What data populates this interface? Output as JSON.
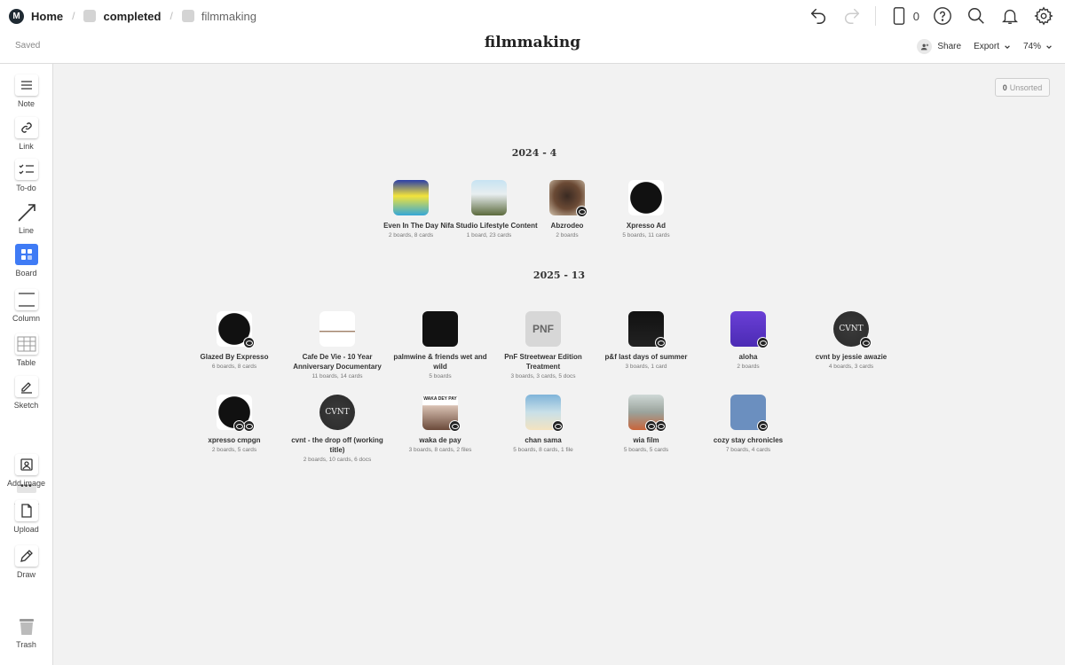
{
  "breadcrumbs": [
    {
      "label": "Home"
    },
    {
      "label": "completed"
    },
    {
      "label": "filmmaking"
    }
  ],
  "status": "Saved",
  "title": "filmmaking",
  "device_count": "0",
  "actions": {
    "share": "Share",
    "export": "Export",
    "zoom": "74%"
  },
  "tools": [
    {
      "label": "Note",
      "icon": "note-icon"
    },
    {
      "label": "Link",
      "icon": "link-icon"
    },
    {
      "label": "To-do",
      "icon": "todo-icon"
    },
    {
      "label": "Line",
      "icon": "line-icon"
    },
    {
      "label": "Board",
      "icon": "board-icon"
    },
    {
      "label": "Column",
      "icon": "column-icon"
    },
    {
      "label": "Table",
      "icon": "table-icon"
    },
    {
      "label": "Sketch",
      "icon": "sketch-icon"
    },
    {
      "label": "Add image",
      "icon": "add-image-icon"
    },
    {
      "label": "Upload",
      "icon": "upload-icon"
    },
    {
      "label": "Draw",
      "icon": "draw-icon"
    },
    {
      "label": "Trash",
      "icon": "trash-icon"
    }
  ],
  "unsorted": {
    "count": "0",
    "label": "Unsorted"
  },
  "sections": [
    {
      "title": "2024 - 4",
      "boards": [
        {
          "name": "Even In The Day",
          "meta": "2 boards, 8 cards",
          "thumb": "even",
          "badges": 0
        },
        {
          "name": "Nifa Studio Lifestyle Content",
          "meta": "1 board, 23 cards",
          "thumb": "nifa",
          "badges": 0
        },
        {
          "name": "Abzrodeo",
          "meta": "2 boards",
          "thumb": "abz",
          "badges": 1
        },
        {
          "name": "Xpresso Ad",
          "meta": "5 boards, 11 cards",
          "thumb": "xpresso",
          "badges": 0
        }
      ]
    },
    {
      "title": "2025 - 13",
      "boards": [
        {
          "name": "Glazed By Expresso",
          "meta": "6 boards, 8 cards",
          "thumb": "xpresso",
          "badges": 1
        },
        {
          "name": "Cafe De Vie - 10 Year Anniversary Documentary",
          "meta": "11 boards, 14 cards",
          "thumb": "cafe",
          "badges": 0
        },
        {
          "name": "palmwine & friends wet and wild",
          "meta": "5 boards",
          "thumb": "palm",
          "badges": 0
        },
        {
          "name": "PnF Streetwear Edition Treatment",
          "meta": "3 boards, 3 cards, 5 docs",
          "thumb": "pnf",
          "thumb_text": "PNF",
          "badges": 0
        },
        {
          "name": "p&f last days of summer",
          "meta": "3 boards, 1 card",
          "thumb": "pf",
          "badges": 1
        },
        {
          "name": "aloha",
          "meta": "2 boards",
          "thumb": "aloha",
          "badges": 1
        },
        {
          "name": "cvnt by jessie awazie",
          "meta": "4 boards, 3 cards",
          "thumb": "cvnt",
          "thumb_text": "CVNT",
          "badges": 1
        },
        {
          "name": "xpresso cmpgn",
          "meta": "2 boards, 5 cards",
          "thumb": "xpresso",
          "badges": 2
        },
        {
          "name": "cvnt - the drop off (working title)",
          "meta": "2 boards, 10 cards, 6 docs",
          "thumb": "cvnt",
          "thumb_text": "CVNT",
          "badges": 0
        },
        {
          "name": "waka de pay",
          "meta": "3 boards, 8 cards, 2 files",
          "thumb": "waka",
          "thumb_text": "WAKA DEY PAY",
          "badges": 1
        },
        {
          "name": "chan sama",
          "meta": "5 boards, 8 cards, 1 file",
          "thumb": "chan",
          "badges": 1
        },
        {
          "name": "wia film",
          "meta": "5 boards, 5 cards",
          "thumb": "wia",
          "badges": 2
        },
        {
          "name": "cozy stay chronicles",
          "meta": "7 boards, 4 cards",
          "thumb": "cozy",
          "badges": 1
        }
      ]
    }
  ]
}
